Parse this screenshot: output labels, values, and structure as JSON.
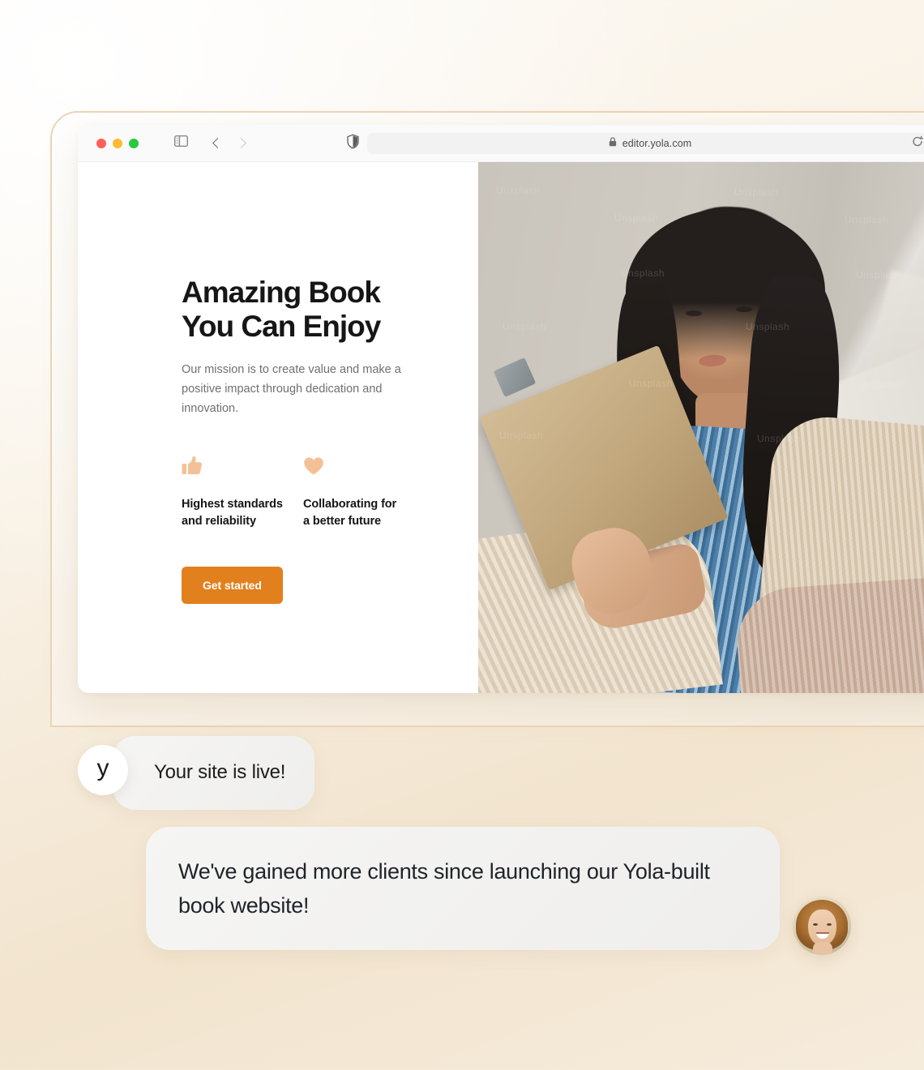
{
  "browser": {
    "traffic_lights": [
      "close",
      "minimize",
      "maximize"
    ],
    "sidebar_icon": "sidebar-toggle-icon",
    "back_icon": "chevron-left-icon",
    "forward_icon": "chevron-right-icon",
    "shield_icon": "shield-icon",
    "lock_icon": "lock-icon",
    "url": "editor.yola.com",
    "reload_icon": "reload-icon"
  },
  "site": {
    "hero": {
      "title": "Amazing Book\nYou Can Enjoy",
      "subtitle": "Our mission is to create value and make a positive impact through dedication and innovation.",
      "cta_label": "Get started"
    },
    "features": [
      {
        "icon": "thumbs-up-icon",
        "label": "Highest standards\nand reliability"
      },
      {
        "icon": "heart-icon",
        "label": "Collaborating for\na better future"
      }
    ],
    "photo": {
      "alt": "woman-reading-book",
      "watermarks": [
        "Unsplash",
        "Unsplash",
        "Unsplash",
        "Unsplash",
        "Unsplash",
        "Unsplash",
        "Unsplash",
        "Unsplash",
        "Unsplash",
        "Unsplash",
        "Unsplash",
        "Unsplash"
      ]
    }
  },
  "chat": {
    "messages": [
      {
        "avatar": "yola-logo-avatar",
        "avatar_letter": "y",
        "text": "Your site is live!"
      },
      {
        "avatar": "user-photo-avatar",
        "text": "We've gained more clients since launching our Yola-built book website!"
      }
    ]
  },
  "colors": {
    "accent_orange": "#E2801E",
    "feature_icon": "#F3C195",
    "frame_border": "#EBD5B5",
    "bubble_bg": "#F2F1EF",
    "heading": "#161616"
  }
}
